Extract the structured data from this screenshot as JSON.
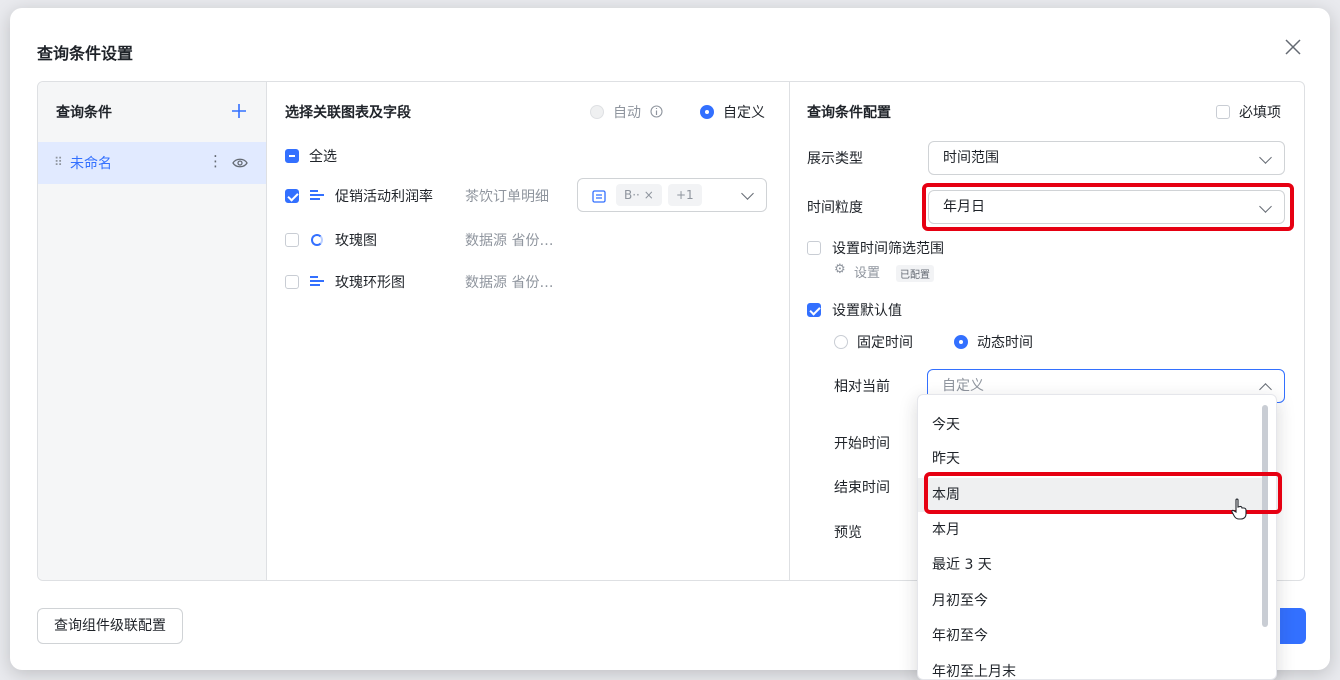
{
  "dialog": {
    "title": "查询条件设置"
  },
  "left": {
    "header": "查询条件",
    "item_label": "未命名"
  },
  "middle": {
    "header": "选择关联图表及字段",
    "mode_auto": "自动",
    "mode_custom": "自定义",
    "select_all": "全选",
    "rows": [
      {
        "name": "促销活动利润率",
        "source": "茶饮订单明细",
        "checked": true,
        "icon": "bar-chart-icon"
      },
      {
        "name": "玫瑰图",
        "source": "数据源 省份…",
        "checked": false,
        "icon": "rose-chart-icon"
      },
      {
        "name": "玫瑰环形图",
        "source": "数据源 省份…",
        "checked": false,
        "icon": "bar-chart-icon"
      }
    ],
    "field_tag": "B··",
    "field_more": "+1"
  },
  "right": {
    "header": "查询条件配置",
    "required_label": "必填项",
    "display_type_label": "展示类型",
    "display_type_value": "时间范围",
    "granularity_label": "时间粒度",
    "granularity_value": "年月日",
    "filter_range_label": "设置时间筛选范围",
    "settings_link": "设置",
    "configured_badge": "已配置",
    "default_value_label": "设置默认值",
    "fixed_time": "固定时间",
    "dynamic_time": "动态时间",
    "relative_label": "相对当前",
    "relative_placeholder": "自定义",
    "start_label": "开始时间",
    "end_label": "结束时间",
    "preview_label": "预览"
  },
  "dropdown": {
    "options": [
      "今天",
      "昨天",
      "本周",
      "本月",
      "最近 3 天",
      "月初至今",
      "年初至今",
      "年初至上月末"
    ],
    "hovered": "本周"
  },
  "footer": {
    "cascade_button": "查询组件级联配置"
  },
  "colors": {
    "accent": "#3370ff",
    "highlight": "#e60012"
  }
}
